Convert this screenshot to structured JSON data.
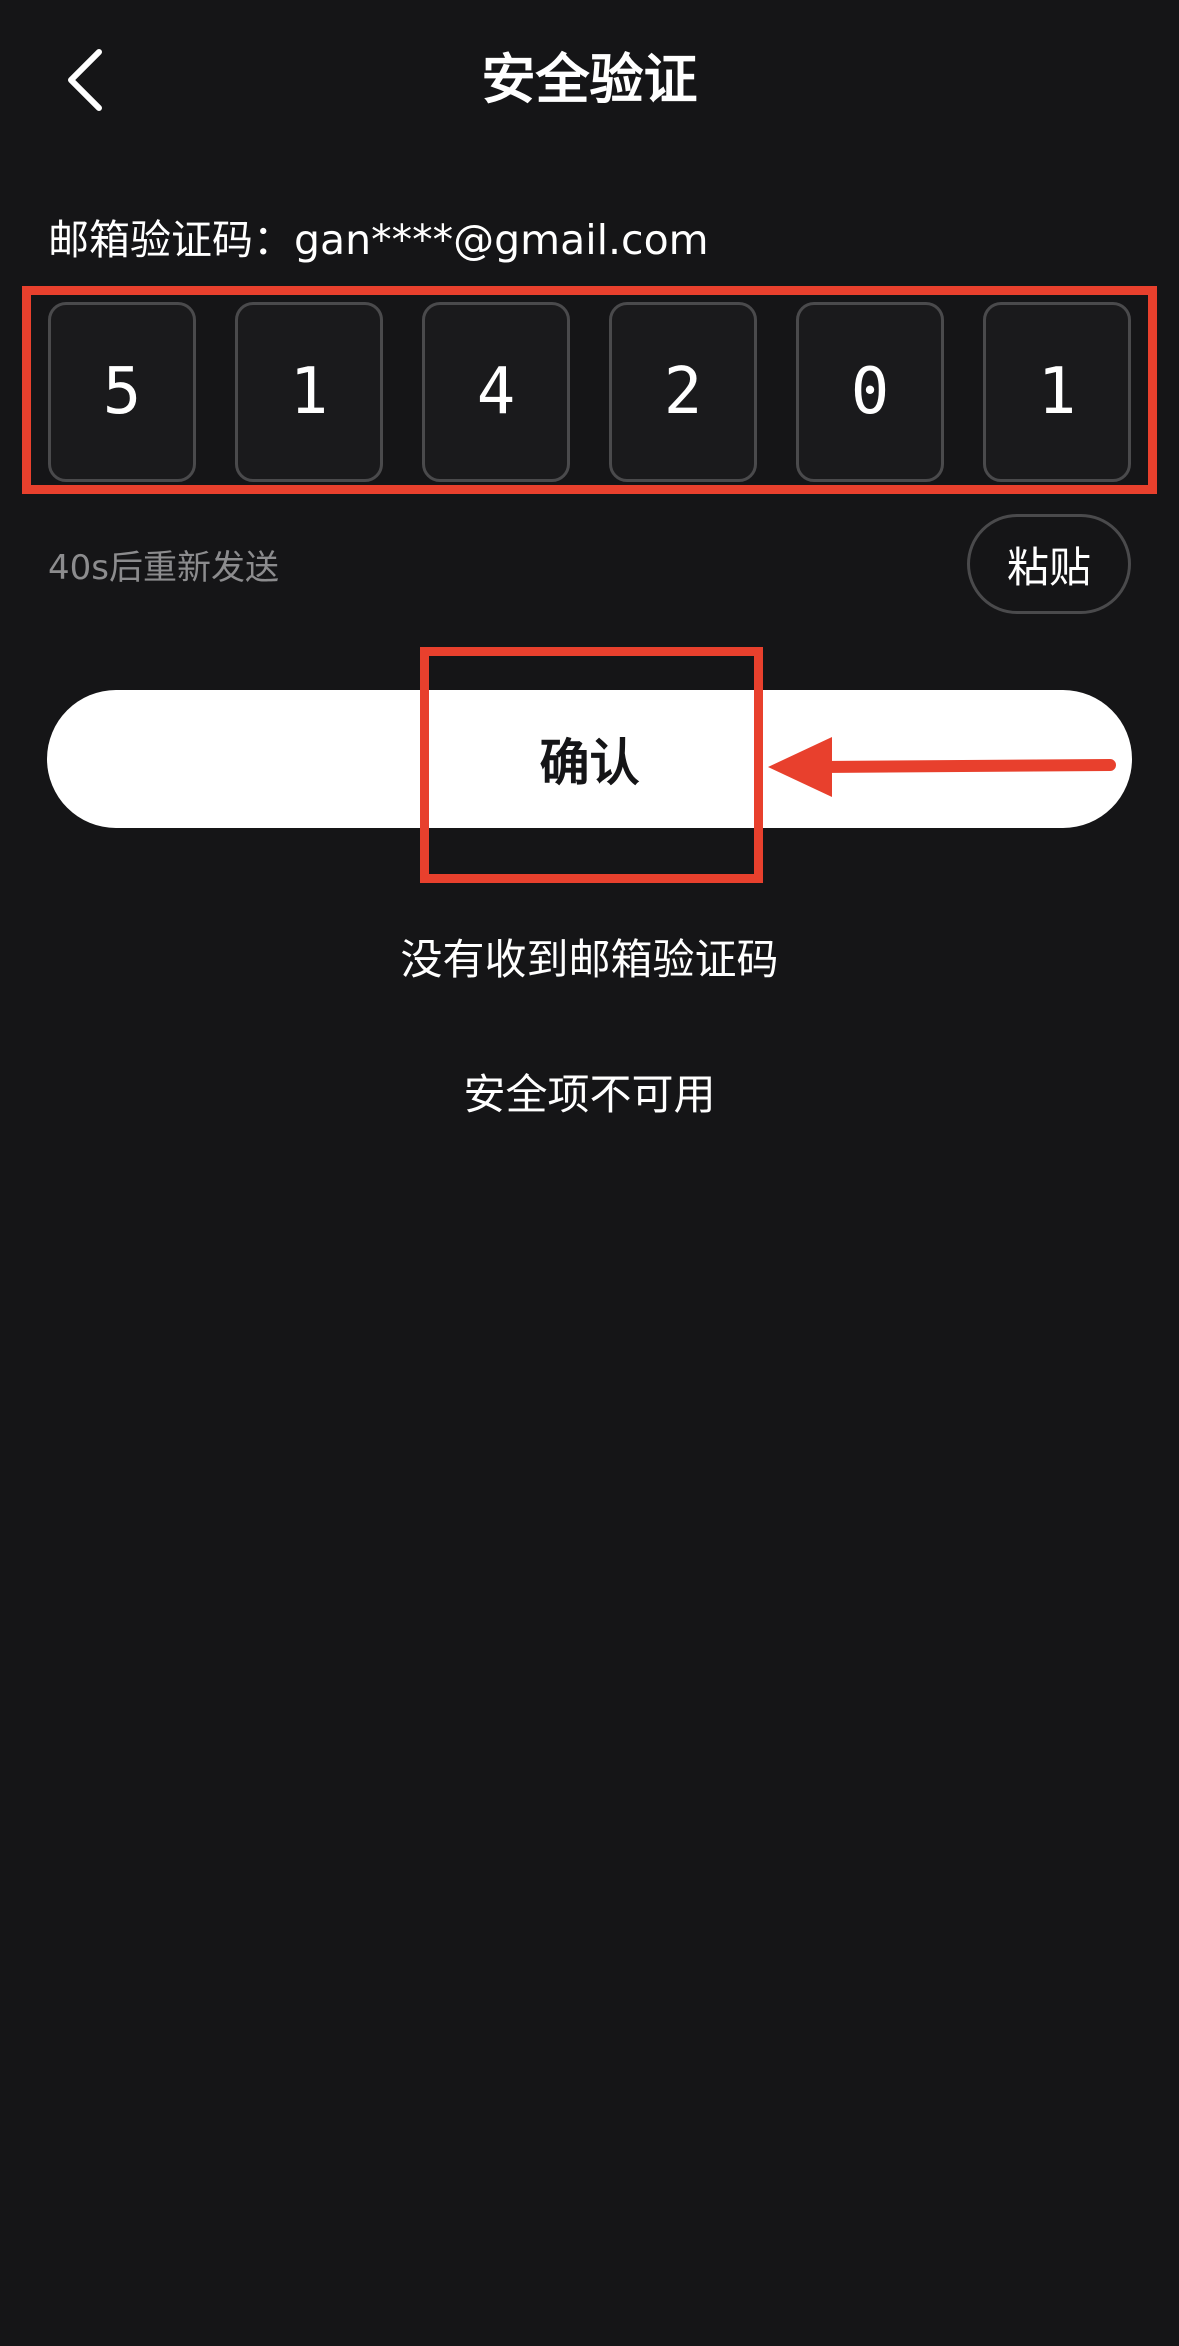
{
  "header": {
    "title": "安全验证",
    "back_icon": "chevron-left-icon"
  },
  "email": {
    "label": "邮箱验证码：gan****@gmail.com"
  },
  "code": {
    "digits": [
      "5",
      "1",
      "4",
      "2",
      "0",
      "1"
    ]
  },
  "resend": {
    "text": "40s后重新发送"
  },
  "paste": {
    "label": "粘贴"
  },
  "confirm": {
    "label": "确认"
  },
  "links": {
    "no_code": "没有收到邮箱验证码",
    "unavailable": "安全项不可用"
  },
  "colors": {
    "background": "#151517",
    "annotation": "#e8402d",
    "box_border": "#4a4a4c",
    "muted_text": "#8c8c8e"
  }
}
